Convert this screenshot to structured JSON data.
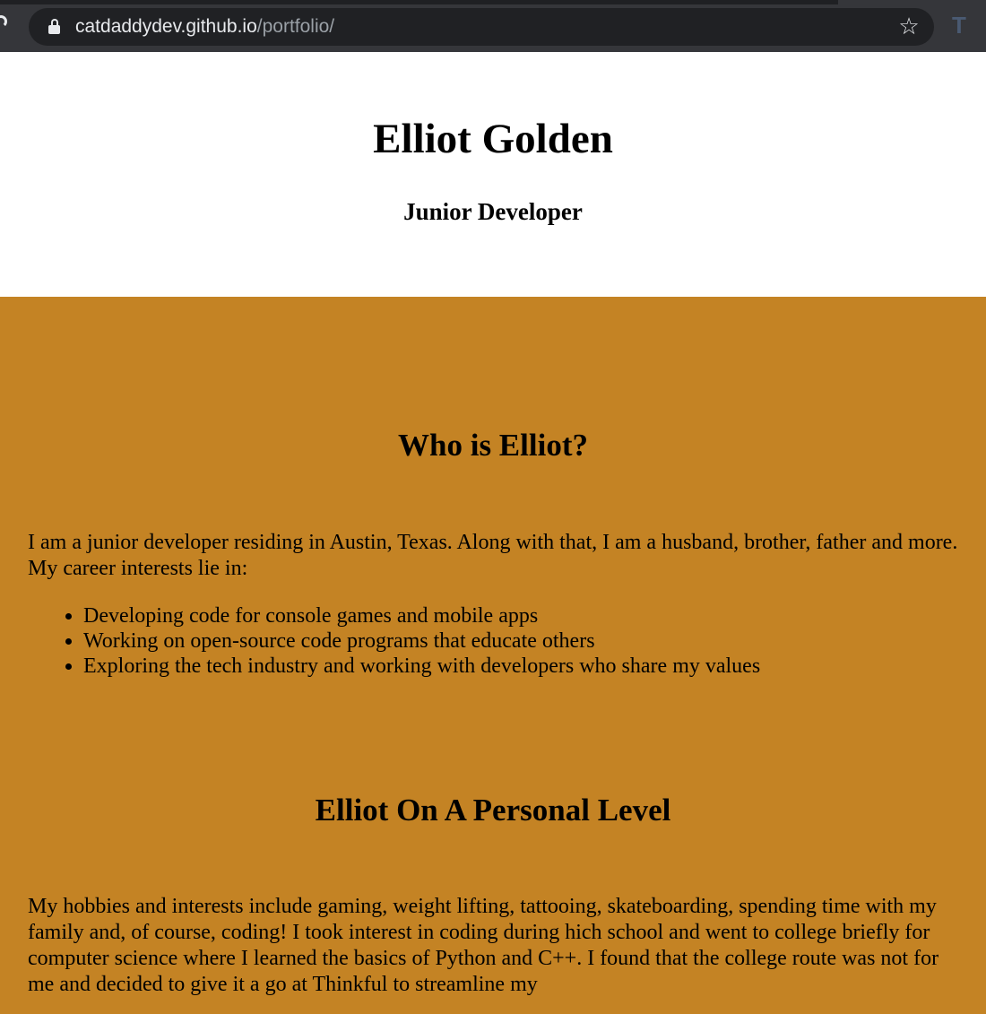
{
  "browser": {
    "url_host": "catdaddydev.github.io",
    "url_path": "/portfolio/"
  },
  "header": {
    "name": "Elliot Golden",
    "role": "Junior Developer"
  },
  "about": {
    "title": "Who is Elliot?",
    "intro": "I am a junior developer residing in Austin, Texas. Along with that, I am a husband, brother, father and more. My career interests lie in:",
    "interests": [
      "Developing code for console games and mobile apps",
      "Working on open-source code programs that educate others",
      "Exploring the tech industry and working with developers who share my values"
    ]
  },
  "personal": {
    "title": "Elliot On A Personal Level",
    "text": "My hobbies and interests include gaming, weight lifting, tattooing, skateboarding, spending time with my family and, of course, coding! I took interest in coding during hich school and went to college briefly for computer science where I learned the basics of Python and C++. I found that the college route was not for me and decided to give it a go at Thinkful to streamline my"
  },
  "colors": {
    "section_bg": "#c48324",
    "chrome_bg": "#35363a",
    "omnibox_bg": "#202124"
  }
}
